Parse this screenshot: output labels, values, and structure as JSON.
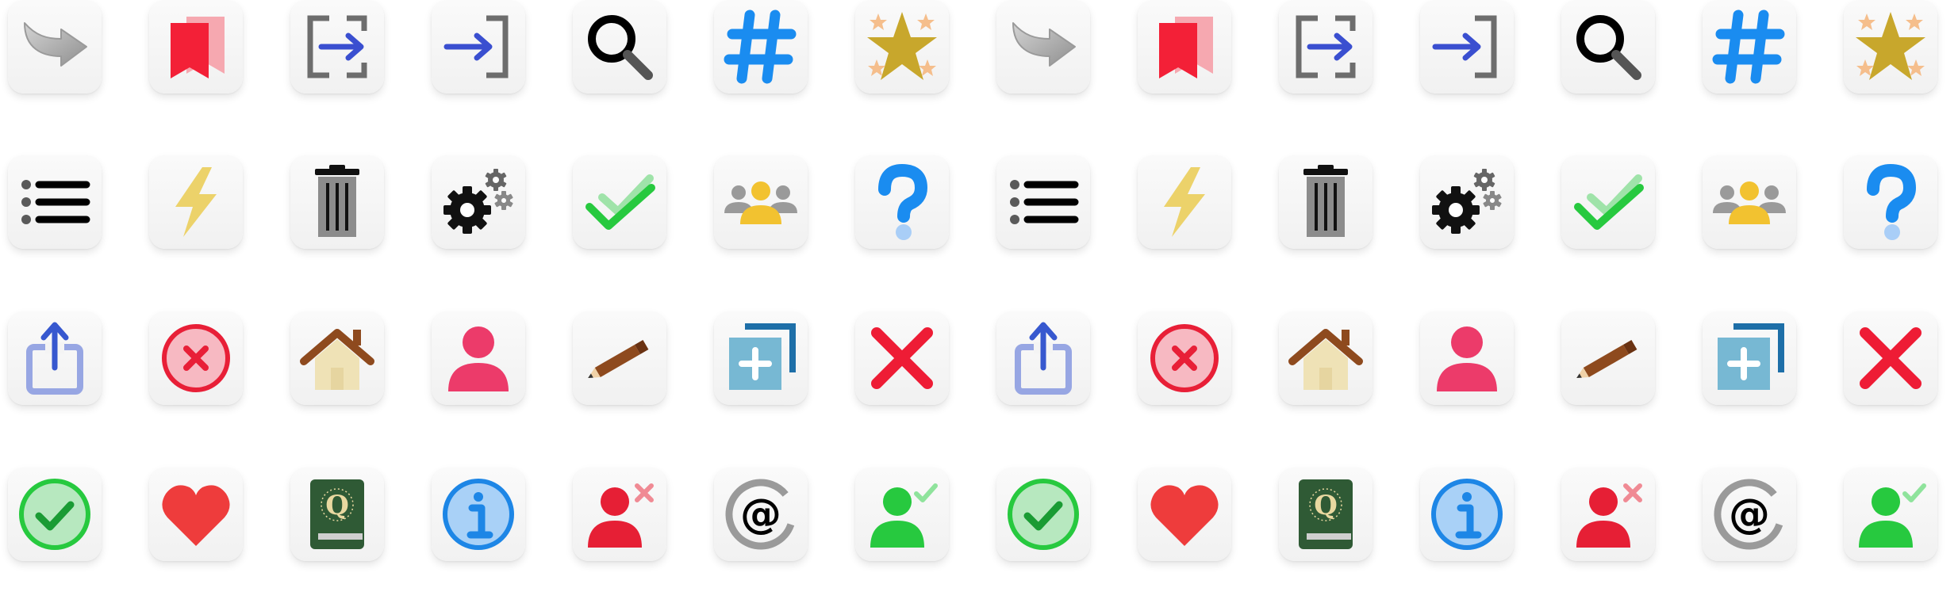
{
  "icon_grid": {
    "rows": [
      [
        "redo-arrow-icon",
        "bookmarks-icon",
        "logout-icon",
        "login-icon",
        "search-icon",
        "hashtag-icon",
        "stars-icon",
        "redo-arrow-icon",
        "bookmarks-icon",
        "logout-icon",
        "login-icon",
        "search-icon",
        "hashtag-icon",
        "stars-icon"
      ],
      [
        "list-icon",
        "lightning-icon",
        "trash-icon",
        "settings-gears-icon",
        "double-check-icon",
        "group-icon",
        "help-question-icon",
        "list-icon",
        "lightning-icon",
        "trash-icon",
        "settings-gears-icon",
        "double-check-icon",
        "group-icon",
        "help-question-icon"
      ],
      [
        "share-icon",
        "cancel-circle-icon",
        "home-icon",
        "user-icon",
        "pencil-icon",
        "add-copy-icon",
        "close-x-icon",
        "share-icon",
        "cancel-circle-icon",
        "home-icon",
        "user-icon",
        "pencil-icon",
        "add-copy-icon",
        "close-x-icon"
      ],
      [
        "check-circle-icon",
        "heart-icon",
        "quran-book-icon",
        "info-icon",
        "user-remove-icon",
        "at-sign-icon",
        "user-check-icon",
        "check-circle-icon",
        "heart-icon",
        "quran-book-icon",
        "info-icon",
        "user-remove-icon",
        "at-sign-icon",
        "user-check-icon"
      ]
    ],
    "book_cover_letter": "Q",
    "colors": {
      "tile_background": "#f4f4f4",
      "bookmark_red": "#f32037",
      "arrow_blue": "#3a4fd0",
      "hashtag_blue": "#1a8cf0",
      "star_gold": "#c8a72c",
      "check_green": "#27c93f",
      "group_yellow": "#f2c230",
      "user_pink": "#ec3b6a",
      "pencil_brown": "#8e4a1e",
      "add_copy_teal": "#77b8d3",
      "close_red": "#ee1c35",
      "heart_red": "#ee3c3c",
      "book_green": "#2f5a35",
      "info_blue": "#1d86e6",
      "user_remove_red": "#e61f35",
      "at_sign_gray": "#9a9a9a"
    }
  }
}
